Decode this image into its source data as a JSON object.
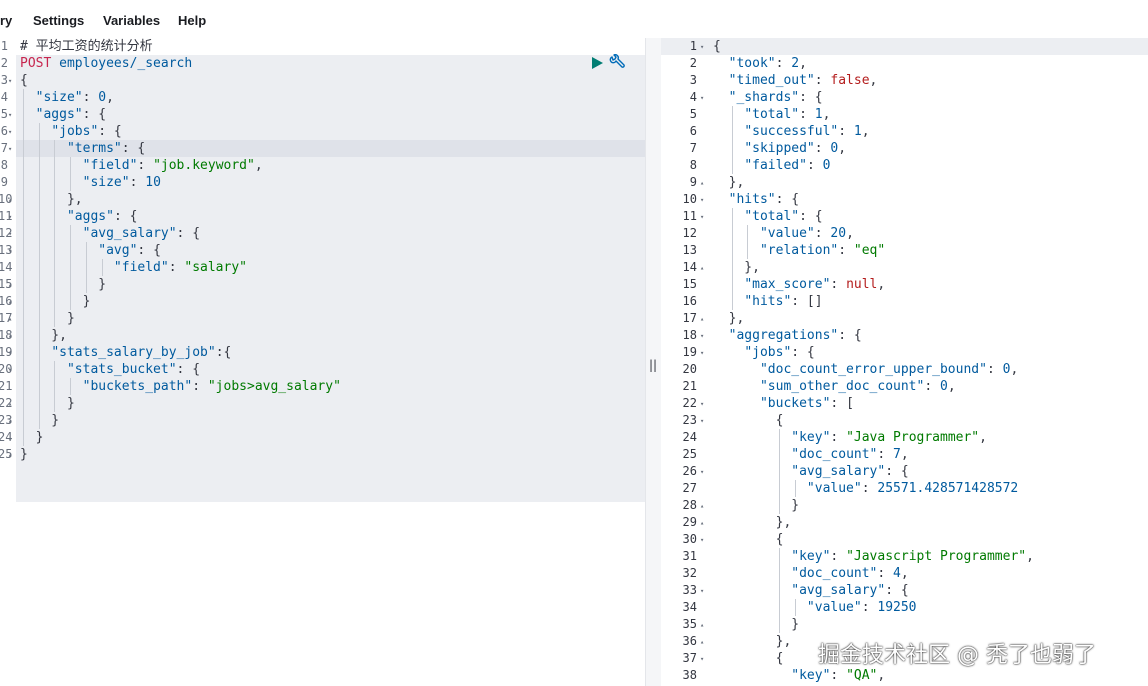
{
  "menubar": {
    "items": [
      "ry",
      "Settings",
      "Variables",
      "Help"
    ]
  },
  "request_editor": {
    "actions": {
      "run_icon": "play-icon",
      "settings_icon": "wrench-icon"
    },
    "lines": [
      {
        "n": "1",
        "fold": "",
        "tokens": [
          [
            "c",
            "# 平均工资的统计分析"
          ]
        ]
      },
      {
        "n": "2",
        "fold": "",
        "tokens": [
          [
            "m",
            "POST"
          ],
          [
            "p",
            " "
          ],
          [
            "u",
            "employees/_search"
          ]
        ]
      },
      {
        "n": "3",
        "fold": "▾",
        "tokens": [
          [
            "p",
            "{"
          ]
        ]
      },
      {
        "n": "4",
        "fold": "",
        "tokens": [
          [
            "p",
            "  "
          ],
          [
            "k",
            "\"size\""
          ],
          [
            "p",
            ": "
          ],
          [
            "n",
            "0"
          ],
          [
            "p",
            ","
          ]
        ]
      },
      {
        "n": "5",
        "fold": "▾",
        "tokens": [
          [
            "p",
            "  "
          ],
          [
            "k",
            "\"aggs\""
          ],
          [
            "p",
            ": {"
          ]
        ]
      },
      {
        "n": "6",
        "fold": "▾",
        "tokens": [
          [
            "p",
            "    "
          ],
          [
            "k",
            "\"jobs\""
          ],
          [
            "p",
            ": {"
          ]
        ]
      },
      {
        "n": "7",
        "fold": "▾",
        "tokens": [
          [
            "p",
            "      "
          ],
          [
            "k",
            "\"terms\""
          ],
          [
            "p",
            ": {"
          ]
        ]
      },
      {
        "n": "8",
        "fold": "",
        "tokens": [
          [
            "p",
            "        "
          ],
          [
            "k",
            "\"field\""
          ],
          [
            "p",
            ": "
          ],
          [
            "s",
            "\"job.keyword\""
          ],
          [
            "p",
            ","
          ]
        ]
      },
      {
        "n": "9",
        "fold": "",
        "tokens": [
          [
            "p",
            "        "
          ],
          [
            "k",
            "\"size\""
          ],
          [
            "p",
            ": "
          ],
          [
            "n",
            "10"
          ]
        ]
      },
      {
        "n": "10",
        "fold": "▴",
        "tokens": [
          [
            "p",
            "      },"
          ]
        ]
      },
      {
        "n": "11",
        "fold": "▾",
        "tokens": [
          [
            "p",
            "      "
          ],
          [
            "k",
            "\"aggs\""
          ],
          [
            "p",
            ": {"
          ]
        ]
      },
      {
        "n": "12",
        "fold": "▾",
        "tokens": [
          [
            "p",
            "        "
          ],
          [
            "k",
            "\"avg_salary\""
          ],
          [
            "p",
            ": {"
          ]
        ]
      },
      {
        "n": "13",
        "fold": "▾",
        "tokens": [
          [
            "p",
            "          "
          ],
          [
            "k",
            "\"avg\""
          ],
          [
            "p",
            ": {"
          ]
        ]
      },
      {
        "n": "14",
        "fold": "",
        "tokens": [
          [
            "p",
            "            "
          ],
          [
            "k",
            "\"field\""
          ],
          [
            "p",
            ": "
          ],
          [
            "s",
            "\"salary\""
          ]
        ]
      },
      {
        "n": "15",
        "fold": "▴",
        "tokens": [
          [
            "p",
            "          }"
          ]
        ]
      },
      {
        "n": "16",
        "fold": "▴",
        "tokens": [
          [
            "p",
            "        }"
          ]
        ]
      },
      {
        "n": "17",
        "fold": "▴",
        "tokens": [
          [
            "p",
            "      }"
          ]
        ]
      },
      {
        "n": "18",
        "fold": "▴",
        "tokens": [
          [
            "p",
            "    },"
          ]
        ]
      },
      {
        "n": "19",
        "fold": "▾",
        "tokens": [
          [
            "p",
            "    "
          ],
          [
            "k",
            "\"stats_salary_by_job\""
          ],
          [
            "p",
            ":{"
          ]
        ]
      },
      {
        "n": "20",
        "fold": "▾",
        "tokens": [
          [
            "p",
            "      "
          ],
          [
            "k",
            "\"stats_bucket\""
          ],
          [
            "p",
            ": {"
          ]
        ]
      },
      {
        "n": "21",
        "fold": "",
        "tokens": [
          [
            "p",
            "        "
          ],
          [
            "k",
            "\"buckets_path\""
          ],
          [
            "p",
            ": "
          ],
          [
            "s",
            "\"jobs>avg_salary\""
          ]
        ]
      },
      {
        "n": "22",
        "fold": "▴",
        "tokens": [
          [
            "p",
            "      }"
          ]
        ]
      },
      {
        "n": "23",
        "fold": "▴",
        "tokens": [
          [
            "p",
            "    }"
          ]
        ]
      },
      {
        "n": "24",
        "fold": "▴",
        "tokens": [
          [
            "p",
            "  }"
          ]
        ]
      },
      {
        "n": "25",
        "fold": "▴",
        "tokens": [
          [
            "p",
            "}"
          ]
        ]
      }
    ]
  },
  "divider": {
    "handle": "||"
  },
  "response_viewer": {
    "lines": [
      {
        "n": "1",
        "fold": "▾",
        "tokens": [
          [
            "p",
            "{"
          ]
        ]
      },
      {
        "n": "2",
        "fold": "",
        "tokens": [
          [
            "p",
            "  "
          ],
          [
            "k",
            "\"took\""
          ],
          [
            "p",
            ": "
          ],
          [
            "n",
            "2"
          ],
          [
            "p",
            ","
          ]
        ]
      },
      {
        "n": "3",
        "fold": "",
        "tokens": [
          [
            "p",
            "  "
          ],
          [
            "k",
            "\"timed_out\""
          ],
          [
            "p",
            ": "
          ],
          [
            "b",
            "false"
          ],
          [
            "p",
            ","
          ]
        ]
      },
      {
        "n": "4",
        "fold": "▾",
        "tokens": [
          [
            "p",
            "  "
          ],
          [
            "k",
            "\"_shards\""
          ],
          [
            "p",
            ": {"
          ]
        ]
      },
      {
        "n": "5",
        "fold": "",
        "tokens": [
          [
            "p",
            "    "
          ],
          [
            "k",
            "\"total\""
          ],
          [
            "p",
            ": "
          ],
          [
            "n",
            "1"
          ],
          [
            "p",
            ","
          ]
        ]
      },
      {
        "n": "6",
        "fold": "",
        "tokens": [
          [
            "p",
            "    "
          ],
          [
            "k",
            "\"successful\""
          ],
          [
            "p",
            ": "
          ],
          [
            "n",
            "1"
          ],
          [
            "p",
            ","
          ]
        ]
      },
      {
        "n": "7",
        "fold": "",
        "tokens": [
          [
            "p",
            "    "
          ],
          [
            "k",
            "\"skipped\""
          ],
          [
            "p",
            ": "
          ],
          [
            "n",
            "0"
          ],
          [
            "p",
            ","
          ]
        ]
      },
      {
        "n": "8",
        "fold": "",
        "tokens": [
          [
            "p",
            "    "
          ],
          [
            "k",
            "\"failed\""
          ],
          [
            "p",
            ": "
          ],
          [
            "n",
            "0"
          ]
        ]
      },
      {
        "n": "9",
        "fold": "▴",
        "tokens": [
          [
            "p",
            "  },"
          ]
        ]
      },
      {
        "n": "10",
        "fold": "▾",
        "tokens": [
          [
            "p",
            "  "
          ],
          [
            "k",
            "\"hits\""
          ],
          [
            "p",
            ": {"
          ]
        ]
      },
      {
        "n": "11",
        "fold": "▾",
        "tokens": [
          [
            "p",
            "    "
          ],
          [
            "k",
            "\"total\""
          ],
          [
            "p",
            ": {"
          ]
        ]
      },
      {
        "n": "12",
        "fold": "",
        "tokens": [
          [
            "p",
            "      "
          ],
          [
            "k",
            "\"value\""
          ],
          [
            "p",
            ": "
          ],
          [
            "n",
            "20"
          ],
          [
            "p",
            ","
          ]
        ]
      },
      {
        "n": "13",
        "fold": "",
        "tokens": [
          [
            "p",
            "      "
          ],
          [
            "k",
            "\"relation\""
          ],
          [
            "p",
            ": "
          ],
          [
            "s",
            "\"eq\""
          ]
        ]
      },
      {
        "n": "14",
        "fold": "▴",
        "tokens": [
          [
            "p",
            "    },"
          ]
        ]
      },
      {
        "n": "15",
        "fold": "",
        "tokens": [
          [
            "p",
            "    "
          ],
          [
            "k",
            "\"max_score\""
          ],
          [
            "p",
            ": "
          ],
          [
            "b",
            "null"
          ],
          [
            "p",
            ","
          ]
        ]
      },
      {
        "n": "16",
        "fold": "",
        "tokens": [
          [
            "p",
            "    "
          ],
          [
            "k",
            "\"hits\""
          ],
          [
            "p",
            ": []"
          ]
        ]
      },
      {
        "n": "17",
        "fold": "▴",
        "tokens": [
          [
            "p",
            "  },"
          ]
        ]
      },
      {
        "n": "18",
        "fold": "▾",
        "tokens": [
          [
            "p",
            "  "
          ],
          [
            "k",
            "\"aggregations\""
          ],
          [
            "p",
            ": {"
          ]
        ]
      },
      {
        "n": "19",
        "fold": "▾",
        "tokens": [
          [
            "p",
            "    "
          ],
          [
            "k",
            "\"jobs\""
          ],
          [
            "p",
            ": {"
          ]
        ]
      },
      {
        "n": "20",
        "fold": "",
        "tokens": [
          [
            "p",
            "      "
          ],
          [
            "k",
            "\"doc_count_error_upper_bound\""
          ],
          [
            "p",
            ": "
          ],
          [
            "n",
            "0"
          ],
          [
            "p",
            ","
          ]
        ]
      },
      {
        "n": "21",
        "fold": "",
        "tokens": [
          [
            "p",
            "      "
          ],
          [
            "k",
            "\"sum_other_doc_count\""
          ],
          [
            "p",
            ": "
          ],
          [
            "n",
            "0"
          ],
          [
            "p",
            ","
          ]
        ]
      },
      {
        "n": "22",
        "fold": "▾",
        "tokens": [
          [
            "p",
            "      "
          ],
          [
            "k",
            "\"buckets\""
          ],
          [
            "p",
            ": ["
          ]
        ]
      },
      {
        "n": "23",
        "fold": "▾",
        "tokens": [
          [
            "p",
            "        {"
          ]
        ]
      },
      {
        "n": "24",
        "fold": "",
        "tokens": [
          [
            "p",
            "          "
          ],
          [
            "k",
            "\"key\""
          ],
          [
            "p",
            ": "
          ],
          [
            "s",
            "\"Java Programmer\""
          ],
          [
            "p",
            ","
          ]
        ]
      },
      {
        "n": "25",
        "fold": "",
        "tokens": [
          [
            "p",
            "          "
          ],
          [
            "k",
            "\"doc_count\""
          ],
          [
            "p",
            ": "
          ],
          [
            "n",
            "7"
          ],
          [
            "p",
            ","
          ]
        ]
      },
      {
        "n": "26",
        "fold": "▾",
        "tokens": [
          [
            "p",
            "          "
          ],
          [
            "k",
            "\"avg_salary\""
          ],
          [
            "p",
            ": {"
          ]
        ]
      },
      {
        "n": "27",
        "fold": "",
        "tokens": [
          [
            "p",
            "            "
          ],
          [
            "k",
            "\"value\""
          ],
          [
            "p",
            ": "
          ],
          [
            "n",
            "25571.428571428572"
          ]
        ]
      },
      {
        "n": "28",
        "fold": "▴",
        "tokens": [
          [
            "p",
            "          }"
          ]
        ]
      },
      {
        "n": "29",
        "fold": "▴",
        "tokens": [
          [
            "p",
            "        },"
          ]
        ]
      },
      {
        "n": "30",
        "fold": "▾",
        "tokens": [
          [
            "p",
            "        {"
          ]
        ]
      },
      {
        "n": "31",
        "fold": "",
        "tokens": [
          [
            "p",
            "          "
          ],
          [
            "k",
            "\"key\""
          ],
          [
            "p",
            ": "
          ],
          [
            "s",
            "\"Javascript Programmer\""
          ],
          [
            "p",
            ","
          ]
        ]
      },
      {
        "n": "32",
        "fold": "",
        "tokens": [
          [
            "p",
            "          "
          ],
          [
            "k",
            "\"doc_count\""
          ],
          [
            "p",
            ": "
          ],
          [
            "n",
            "4"
          ],
          [
            "p",
            ","
          ]
        ]
      },
      {
        "n": "33",
        "fold": "▾",
        "tokens": [
          [
            "p",
            "          "
          ],
          [
            "k",
            "\"avg_salary\""
          ],
          [
            "p",
            ": {"
          ]
        ]
      },
      {
        "n": "34",
        "fold": "",
        "tokens": [
          [
            "p",
            "            "
          ],
          [
            "k",
            "\"value\""
          ],
          [
            "p",
            ": "
          ],
          [
            "n",
            "19250"
          ]
        ]
      },
      {
        "n": "35",
        "fold": "▴",
        "tokens": [
          [
            "p",
            "          }"
          ]
        ]
      },
      {
        "n": "36",
        "fold": "▴",
        "tokens": [
          [
            "p",
            "        },"
          ]
        ]
      },
      {
        "n": "37",
        "fold": "▾",
        "tokens": [
          [
            "p",
            "        {"
          ]
        ]
      },
      {
        "n": "38",
        "fold": "",
        "tokens": [
          [
            "p",
            "          "
          ],
          [
            "k",
            "\"key\""
          ],
          [
            "p",
            ": "
          ],
          [
            "s",
            "\"QA\""
          ],
          [
            "p",
            ","
          ]
        ]
      }
    ]
  },
  "watermark": "掘金技术社区 @ 秃了也弱了",
  "colors": {
    "key": "#005a9e",
    "string": "#007a00",
    "number": "#005a9e",
    "boolean": "#b41d1d",
    "method": "#c7254e",
    "run_button": "#017d73",
    "selection": "#eceef2"
  }
}
